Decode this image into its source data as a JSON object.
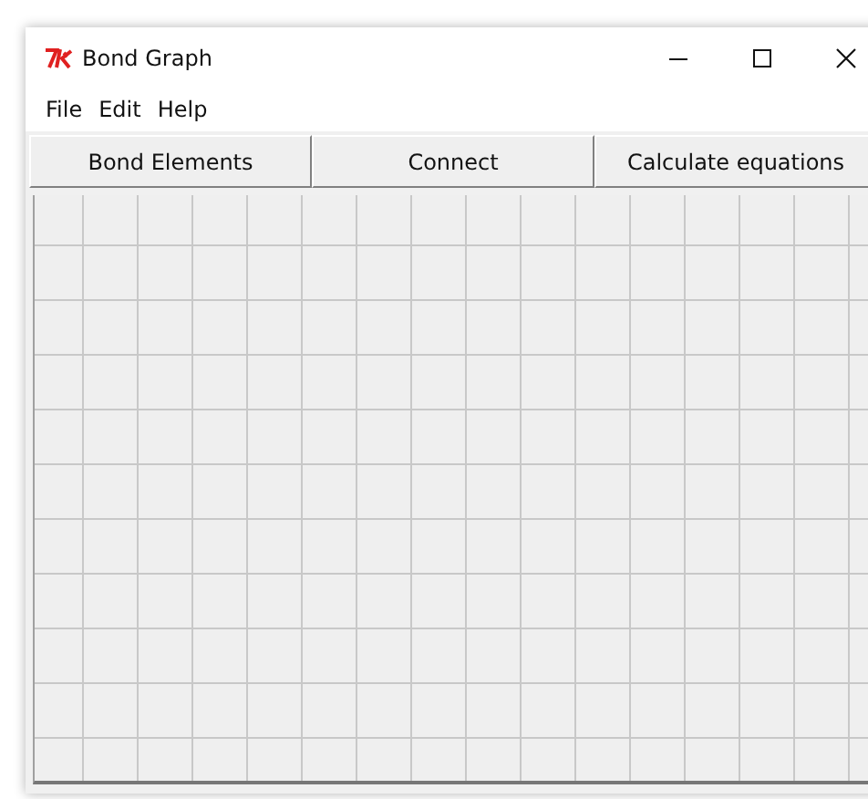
{
  "window": {
    "title": "Bond Graph"
  },
  "menu": [
    "File",
    "Edit",
    "Help"
  ],
  "buttons": [
    "Bond Elements",
    "Connect",
    "Calculate equations"
  ]
}
